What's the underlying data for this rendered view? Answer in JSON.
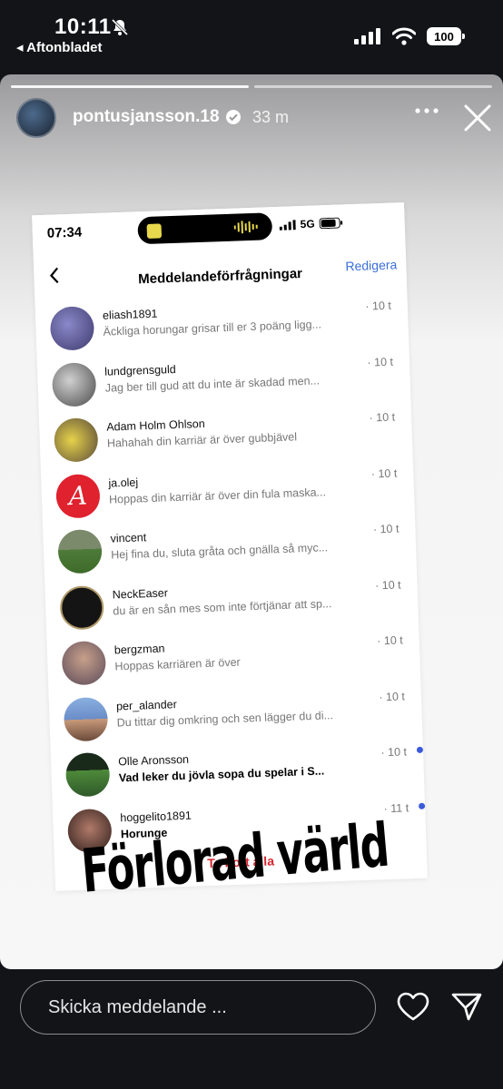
{
  "status_bar": {
    "time": "10:11",
    "back_label": "◂ Aftonbladet",
    "battery": "100"
  },
  "story": {
    "username": "pontusjansson.18",
    "time_ago": "33 m",
    "caption": "Förlorad värld"
  },
  "inner_screenshot": {
    "time": "07:34",
    "network": "5G",
    "title": "Meddelandeförfrågningar",
    "edit_label": "Redigera",
    "delete_all_label": "Ta bort alla",
    "rows": [
      {
        "name": "eliash1891",
        "message": "Äckliga horungar grisar till er 3 poäng ligg...",
        "time": "· 10 t",
        "unread": false,
        "avatar_color": "#3e3a6e"
      },
      {
        "name": "lundgrensguld",
        "message": "Jag ber till gud att du inte är skadad men...",
        "time": "· 10 t",
        "unread": false,
        "avatar_color": "#7a7a7a"
      },
      {
        "name": "Adam Holm Ohlson",
        "message": "Hahahah din karriär är över gubbjävel",
        "time": "· 10 t",
        "unread": false,
        "avatar_color": "#b0a25a"
      },
      {
        "name": "ja.olej",
        "message": "Hoppas din karriär är över din fula maska...",
        "time": "· 10 t",
        "unread": false,
        "avatar_color": "#e0212e"
      },
      {
        "name": "vincent",
        "message": "Hej fina du, sluta gråta och gnälla så myc...",
        "time": "· 10 t",
        "unread": false,
        "avatar_color": "#4e7a3a"
      },
      {
        "name": "NeckEaser",
        "message": "du är en sån mes som inte förtjänar att sp...",
        "time": "· 10 t",
        "unread": false,
        "avatar_color": "#141414"
      },
      {
        "name": "bergzman",
        "message": "Hoppas karriären är över",
        "time": "· 10 t",
        "unread": false,
        "avatar_color": "#8a6a5a"
      },
      {
        "name": "per_alander",
        "message": "Du tittar dig omkring och sen lägger du di...",
        "time": "· 10 t",
        "unread": false,
        "avatar_color": "#6a8cc8"
      },
      {
        "name": "Olle Aronsson",
        "message": "Vad leker du jövla sopa du spelar i S...",
        "time": "· 10 t",
        "unread": true,
        "avatar_color": "#2f5a2a"
      },
      {
        "name": "hoggelito1891",
        "message": "Horunge",
        "time": "· 11 t",
        "unread": true,
        "avatar_color": "#5a3a2e"
      }
    ]
  },
  "bottom_bar": {
    "message_placeholder": "Skicka meddelande ..."
  }
}
